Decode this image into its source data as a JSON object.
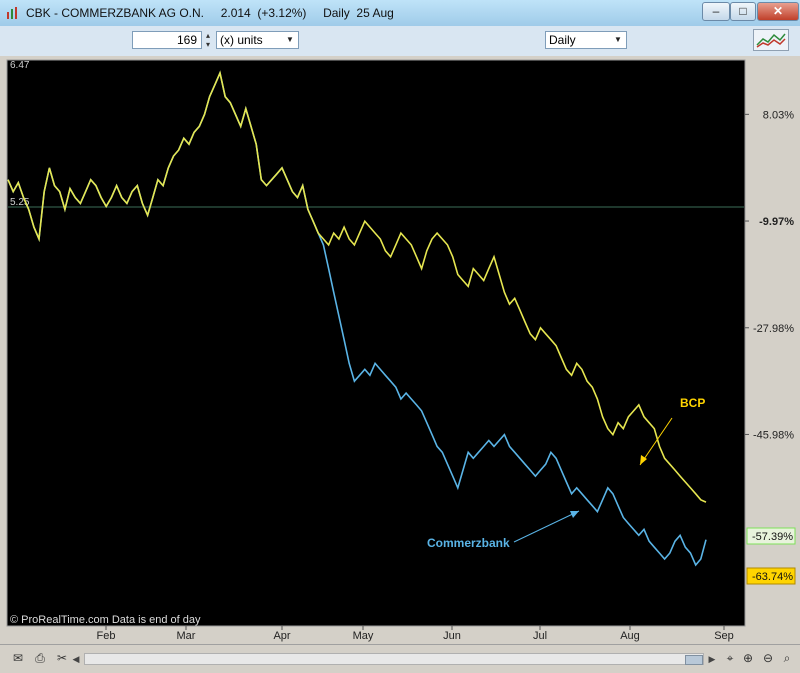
{
  "window": {
    "title": "CBK - COMMERZBANK AG O.N.     2.014  (+3.12%)     Daily  25 Aug",
    "min_label": "–",
    "max_label": "□",
    "close_label": "✕"
  },
  "toolbar": {
    "units_value": "169",
    "units_label": "(x) units",
    "period_label": "Daily"
  },
  "chart_data": {
    "type": "line",
    "xlabel": "",
    "ylabel": "",
    "x_ticks": [
      "Feb",
      "Mar",
      "Apr",
      "May",
      "Jun",
      "Jul",
      "Aug",
      "Sep"
    ],
    "y_ticks": [
      "8.03%",
      "-9.97%",
      "-27.98%",
      "-45.98%"
    ],
    "y_range": [
      17.2,
      -78.3
    ],
    "left_labels": [
      "6.47",
      "5.25"
    ],
    "reference_line_label": "5.25",
    "last_value_labels": [
      {
        "text": "-57.39%",
        "color": "#7ee05a"
      },
      {
        "text": "-63.74%",
        "color": "#ffd400"
      }
    ],
    "annotations": [
      "BCP",
      "Commerzbank"
    ],
    "watermark": "© ProRealTime.com  Data is end of day",
    "series": [
      {
        "name": "BCP",
        "color": "#e6e650",
        "values": [
          -3,
          -5,
          -3.5,
          -6,
          -8,
          -11,
          -13,
          -5,
          -1,
          -4,
          -5,
          -8,
          -4.5,
          -6,
          -7,
          -5,
          -3,
          -4,
          -6,
          -7.5,
          -6,
          -4,
          -6,
          -7,
          -5,
          -4,
          -7,
          -9,
          -6,
          -3,
          -4,
          -1,
          1,
          2,
          4,
          3,
          5,
          6,
          8,
          11,
          13,
          15,
          11,
          10,
          8,
          6,
          9,
          6,
          3,
          -3,
          -4,
          -3,
          -2,
          -1,
          -3,
          -5,
          -6,
          -4,
          -8,
          -10,
          -12,
          -13,
          -14,
          -12,
          -13,
          -11,
          -13,
          -14,
          -12,
          -10,
          -11,
          -12,
          -13,
          -15,
          -16,
          -14,
          -12,
          -13,
          -14,
          -16,
          -18,
          -15,
          -13,
          -12,
          -13,
          -14,
          -16,
          -19,
          -20,
          -21,
          -18,
          -19,
          -20,
          -18,
          -16,
          -19,
          -22,
          -24,
          -23,
          -25,
          -27,
          -29,
          -30,
          -28,
          -29,
          -30,
          -31,
          -33,
          -35,
          -36,
          -34,
          -35,
          -37,
          -38,
          -40,
          -43,
          -45,
          -46,
          -44,
          -45,
          -43,
          -42,
          -41,
          -43,
          -44,
          -45,
          -48,
          -50,
          -51,
          -52,
          -53,
          -54,
          -55,
          -56,
          -57,
          -57.39
        ]
      },
      {
        "name": "Commerzbank",
        "color": "#5ab4e6",
        "values": [
          -3,
          -5,
          -3.5,
          -6,
          -8,
          -11,
          -13,
          -5,
          -1,
          -4,
          -5,
          -8,
          -4.5,
          -6,
          -7,
          -5,
          -3,
          -4,
          -6,
          -7.5,
          -6,
          -4,
          -6,
          -7,
          -5,
          -4,
          -7,
          -9,
          -6,
          -3,
          -4,
          -1,
          1,
          2,
          4,
          3,
          5,
          6,
          8,
          11,
          13,
          15,
          11,
          10,
          8,
          6,
          9,
          6,
          3,
          -3,
          -4,
          -3,
          -2,
          -1,
          -3,
          -5,
          -6,
          -4,
          -8,
          -10,
          -12,
          -14,
          -18,
          -22,
          -26,
          -30,
          -34,
          -37,
          -36,
          -35,
          -36,
          -34,
          -35,
          -36,
          -37,
          -38,
          -40,
          -39,
          -40,
          -41,
          -42,
          -44,
          -46,
          -48,
          -49,
          -51,
          -53,
          -55,
          -52,
          -49,
          -50,
          -49,
          -48,
          -47,
          -48,
          -47,
          -46,
          -48,
          -49,
          -50,
          -51,
          -52,
          -53,
          -52,
          -51,
          -49,
          -50,
          -52,
          -54,
          -56,
          -55,
          -56,
          -57,
          -58,
          -59,
          -57,
          -55,
          -56,
          -58,
          -60,
          -61,
          -62,
          -63,
          -62,
          -64,
          -65,
          -66,
          -67,
          -66,
          -64,
          -63,
          -65,
          -66,
          -68,
          -67,
          -63.74
        ]
      }
    ]
  },
  "bottombar": {
    "icons": [
      "envelope-icon",
      "print-icon",
      "scissors-icon",
      "zoom-icon",
      "zoom-in-icon",
      "zoom-out-icon"
    ]
  }
}
